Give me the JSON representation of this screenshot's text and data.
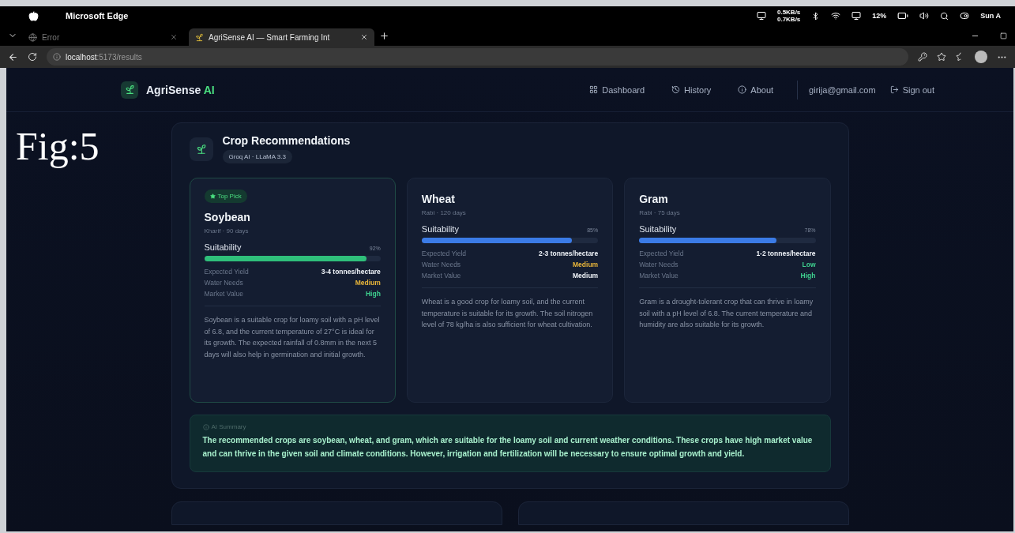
{
  "menu_bar": {
    "app_name": "Microsoft Edge",
    "net_up": "0.5KB/s",
    "net_down": "0.7KB/s",
    "battery": "12%",
    "clock": "Sun A"
  },
  "tabs": [
    {
      "title": "Error",
      "selected": false
    },
    {
      "title": "AgriSense AI — Smart Farming Int",
      "selected": true
    }
  ],
  "address_bar": {
    "host": "localhost",
    "path": ":5173/results"
  },
  "app_header": {
    "brand": "AgriSense",
    "brand_accent": "AI",
    "nav": [
      {
        "kind": "grid",
        "label": "Dashboard"
      },
      {
        "kind": "history",
        "label": "History"
      },
      {
        "kind": "info",
        "label": "About"
      }
    ],
    "user": "girija@gmail.com",
    "sign_out": "Sign out"
  },
  "figure_label": "Fig:5",
  "panel": {
    "title": "Crop Recommendations",
    "model_badge": "Groq AI · LLaMA 3.3",
    "crops": [
      {
        "top_pick": true,
        "badge": "Top Pick",
        "name": "Soybean",
        "season": "Kharif · 90 days",
        "suitability_label": "Suitability",
        "percent": "92%",
        "level": 0.92,
        "color": "#2fbf7a",
        "stats": [
          {
            "label": "Expected Yield",
            "value": "3-4 tonnes/hectare",
            "color": "#eef2f7"
          },
          {
            "label": "Water Needs",
            "value": "Medium",
            "color": "#e8b53a"
          },
          {
            "label": "Market Value",
            "value": "High",
            "color": "#3ecf8e"
          }
        ],
        "description": "Soybean is a suitable crop for loamy soil with a pH level of 6.8, and the current temperature of 27°C is ideal for its growth. The expected rainfall of 0.8mm in the next 5 days will also help in germination and initial growth."
      },
      {
        "top_pick": false,
        "name": "Wheat",
        "season": "Rabi · 120 days",
        "suitability_label": "Suitability",
        "percent": "85%",
        "level": 0.85,
        "color": "#3b7be6",
        "stats": [
          {
            "label": "Expected Yield",
            "value": "2-3 tonnes/hectare",
            "color": "#eef2f7"
          },
          {
            "label": "Water Needs",
            "value": "Medium",
            "color": "#e8b53a"
          },
          {
            "label": "Market Value",
            "value": "Medium",
            "color": "#eef2f7"
          }
        ],
        "description": "Wheat is a good crop for loamy soil, and the current temperature is suitable for its growth. The soil nitrogen level of 78 kg/ha is also sufficient for wheat cultivation."
      },
      {
        "top_pick": false,
        "name": "Gram",
        "season": "Rabi · 75 days",
        "suitability_label": "Suitability",
        "percent": "78%",
        "level": 0.78,
        "color": "#3b7be6",
        "stats": [
          {
            "label": "Expected Yield",
            "value": "1-2 tonnes/hectare",
            "color": "#eef2f7"
          },
          {
            "label": "Water Needs",
            "value": "Low",
            "color": "#3ecf8e"
          },
          {
            "label": "Market Value",
            "value": "High",
            "color": "#3ecf8e"
          }
        ],
        "description": "Gram is a drought-tolerant crop that can thrive in loamy soil with a pH level of 6.8. The current temperature and humidity are also suitable for its growth."
      }
    ],
    "summary": {
      "label": "AI Summary",
      "text": "The recommended crops are soybean, wheat, and gram, which are suitable for the loamy soil and current weather conditions. These crops have high market value and can thrive in the given soil and climate conditions. However, irrigation and fertilization will be necessary to ensure optimal growth and yield."
    }
  }
}
